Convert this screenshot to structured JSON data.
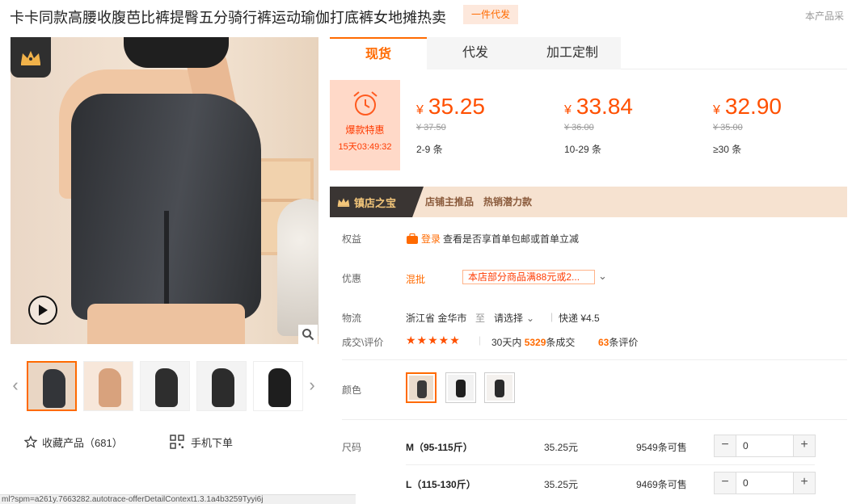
{
  "header": {
    "title": "卡卡同款高腰收腹芭比裤提臀五分骑行裤运动瑜伽打底裤女地摊热卖",
    "dropship_tag": "一件代发",
    "right_text": "本产品采"
  },
  "gallery": {
    "thumbs": [
      {
        "name": "thumb-1",
        "bg": "#e9d6c4",
        "fg": "#333539"
      },
      {
        "name": "thumb-2",
        "bg": "#f7e7da",
        "fg": "#d8a27d"
      },
      {
        "name": "thumb-3",
        "bg": "#f4f4f4",
        "fg": "#2e2e2e"
      },
      {
        "name": "thumb-4",
        "bg": "#f3f3f3",
        "fg": "#2c2c2c"
      },
      {
        "name": "thumb-5",
        "bg": "#ffffff",
        "fg": "#1e1e1e"
      }
    ],
    "favorite_label": "收藏产品（681）",
    "mobile_label": "手机下单"
  },
  "tabs": [
    "现货",
    "代发",
    "加工定制"
  ],
  "deal": {
    "label": "爆款特惠",
    "timer": "15天03:49:32"
  },
  "prices": [
    {
      "currency": "¥",
      "price": "35.25",
      "old": "¥ 37.50",
      "qty": "2-9 条"
    },
    {
      "currency": "¥",
      "price": "33.84",
      "old": "¥ 36.00",
      "qty": "10-29 条"
    },
    {
      "currency": "¥",
      "price": "32.90",
      "old": "¥ 35.00",
      "qty": "≥30 条"
    }
  ],
  "treasure": {
    "title": "镇店之宝",
    "desc": "店铺主推品　热销潜力款"
  },
  "benefits": {
    "label": "权益",
    "login": "登录",
    "text": "查看是否享首单包邮或首单立减"
  },
  "discount": {
    "label": "优惠",
    "mix": "混批",
    "promo": "本店部分商品满88元或2..."
  },
  "logistics": {
    "label": "物流",
    "origin": "浙江省 金华市",
    "to": "至",
    "select": "请选择",
    "express": "快递 ¥4.5"
  },
  "deals_stats": {
    "label": "成交\\评价",
    "stars": "★★★★★",
    "prefix": "30天内",
    "sold": "5329",
    "sold_suffix": "条成交",
    "reviews": "63",
    "reviews_suffix": "条评价"
  },
  "color": {
    "label": "颜色",
    "swatches": [
      {
        "bg": "#eadccd",
        "fg": "#3a3a3a"
      },
      {
        "bg": "#f2f2f2",
        "fg": "#1f1f1f"
      },
      {
        "bg": "#f4f1ee",
        "fg": "#2b2b2b"
      }
    ]
  },
  "sizes": {
    "label": "尺码",
    "rows": [
      {
        "name": "M（95-115斤）",
        "price": "35.25元",
        "stock": "9549条可售",
        "qty": "0"
      },
      {
        "name": "L（115-130斤）",
        "price": "35.25元",
        "stock": "9469条可售",
        "qty": "0"
      }
    ]
  },
  "status_bar": "ml?spm=a261y.7663282.autotrace-offerDetailContext1.3.1a4b3259Tyyi6j",
  "colors": {
    "accent": "#ff6a00",
    "price": "#ff5000"
  }
}
